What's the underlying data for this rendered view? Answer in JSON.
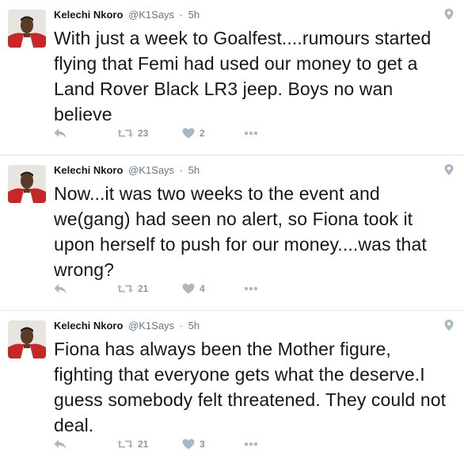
{
  "tweets": [
    {
      "author": "Kelechi Nkoro",
      "handle": "@K1Says",
      "separator": "·",
      "time": "5h",
      "text": "With just a week to Goalfest....rumours started flying that Femi had used our money to get a Land Rover Black LR3 jeep. Boys no wan believe",
      "retweets": "23",
      "likes": "2"
    },
    {
      "author": "Kelechi Nkoro",
      "handle": "@K1Says",
      "separator": "·",
      "time": "5h",
      "text": "Now...it was two weeks to the event and we(gang) had seen no alert, so Fiona took it upon herself to push for our money....was that wrong?",
      "retweets": "21",
      "likes": "4"
    },
    {
      "author": "Kelechi Nkoro",
      "handle": "@K1Says",
      "separator": "·",
      "time": "5h",
      "text": "Fiona has always been the Mother figure, fighting that everyone gets what the deserve.I guess somebody felt threatened. They could not deal.",
      "retweets": "21",
      "likes": "3"
    }
  ],
  "icons": {
    "reply": "reply-icon",
    "retweet": "retweet-icon",
    "like": "heart-icon",
    "more": "more-icon",
    "location": "location-pin-icon",
    "avatar": "avatar"
  },
  "colors": {
    "text": "#14171a",
    "meta": "#657786",
    "icon": "#aab8c2",
    "avatar_bg": "#c0392b"
  }
}
